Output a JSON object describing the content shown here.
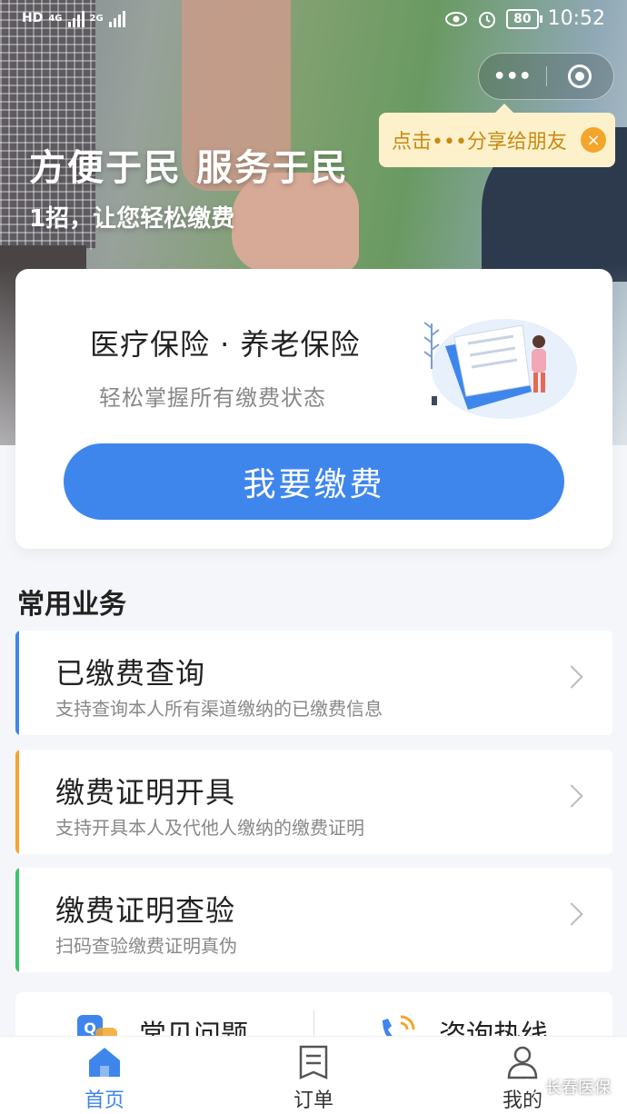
{
  "status_bar": {
    "network_left": "HD",
    "network_4g": "4G",
    "network_2g": "2G",
    "battery": "80",
    "time": "10:52"
  },
  "capsule": {
    "more_icon": "more-dots-icon",
    "close_icon": "target-icon"
  },
  "share_tip": {
    "text": "点击•••分享给朋友",
    "close": "×"
  },
  "hero": {
    "title": "方便于民 服务于民",
    "subtitle": "1招，让您轻松缴费"
  },
  "main_card": {
    "title": "医疗保险 · 养老保险",
    "subtitle": "轻松掌握所有缴费状态",
    "pay_button": "我要缴费"
  },
  "section_title": "常用业务",
  "services": [
    {
      "name": "已缴费查询",
      "desc": "支持查询本人所有渠道缴纳的已缴费信息",
      "accent": "#3f86ec"
    },
    {
      "name": "缴费证明开具",
      "desc": "支持开具本人及代他人缴纳的缴费证明",
      "accent": "#f3a52c"
    },
    {
      "name": "缴费证明查验",
      "desc": "扫码查验缴费证明真伪",
      "accent": "#3cc46b"
    }
  ],
  "quick_links": [
    {
      "label": "常见问题",
      "icon": "faq-icon"
    },
    {
      "label": "咨询热线",
      "icon": "phone-icon"
    }
  ],
  "tabs": [
    {
      "label": "首页",
      "icon": "home-icon",
      "active": true
    },
    {
      "label": "订单",
      "icon": "order-icon",
      "active": false
    },
    {
      "label": "我的",
      "icon": "user-icon",
      "active": false
    }
  ],
  "watermark": "长春医保",
  "colors": {
    "primary": "#3f86ec",
    "orange": "#f3a52c",
    "green": "#3cc46b"
  }
}
